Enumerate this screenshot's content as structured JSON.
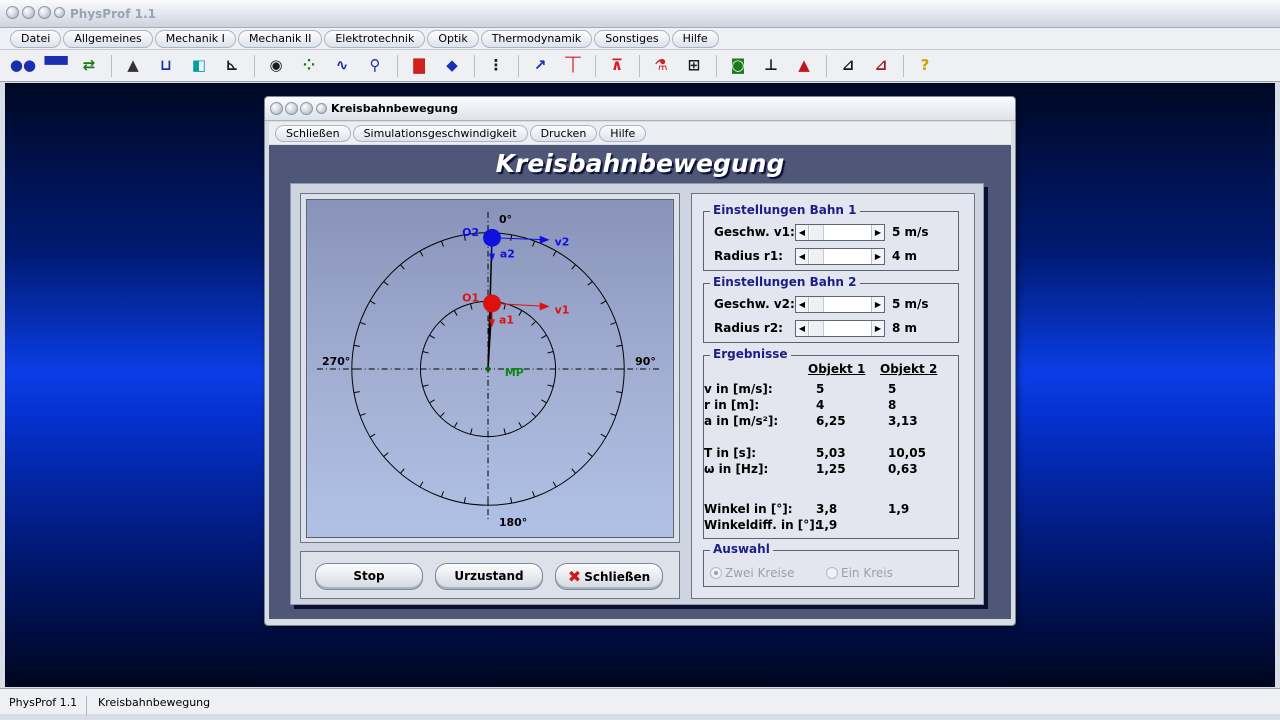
{
  "app": {
    "title": "PhysProf 1.1"
  },
  "menubar": [
    "Datei",
    "Allgemeines",
    "Mechanik I",
    "Mechanik II",
    "Elektrotechnik",
    "Optik",
    "Thermodynamik",
    "Sonstiges",
    "Hilfe"
  ],
  "toolbar": {
    "icons": [
      {
        "name": "collision-icon",
        "glyph": "●●",
        "color": "#1a2fb0"
      },
      {
        "name": "cart-icon",
        "glyph": "▀▀",
        "color": "#1a2fb0"
      },
      {
        "name": "exchange-icon",
        "glyph": "⇄",
        "color": "#1a7a1a"
      },
      {
        "name": "incline-icon",
        "glyph": "▲",
        "color": "#333333"
      },
      {
        "name": "container-icon",
        "glyph": "⊔",
        "color": "#1a2fb0"
      },
      {
        "name": "pulley-icon",
        "glyph": "◧",
        "color": "#00a0a0"
      },
      {
        "name": "graph-icon",
        "glyph": "⊾",
        "color": "#1a1a1a"
      },
      {
        "name": "eye-icon",
        "glyph": "◉",
        "color": "#1a1a1a"
      },
      {
        "name": "dots-icon",
        "glyph": "⁘",
        "color": "#1a7a1a"
      },
      {
        "name": "wave-icon",
        "glyph": "∿",
        "color": "#1a2fb0"
      },
      {
        "name": "orbit-icon",
        "glyph": "⚲",
        "color": "#1a2fb0"
      },
      {
        "name": "magnet-icon",
        "glyph": "▇",
        "color": "#d02020"
      },
      {
        "name": "diamond-icon",
        "glyph": "◆",
        "color": "#1a2fb0"
      },
      {
        "name": "resistor-icon",
        "glyph": "⋮",
        "color": "#1a1a1a"
      },
      {
        "name": "curve-icon",
        "glyph": "↗",
        "color": "#1a2fb0"
      },
      {
        "name": "circuit-icon",
        "glyph": "⏉",
        "color": "#d02020"
      },
      {
        "name": "coil-icon",
        "glyph": "⊼",
        "color": "#d02020"
      },
      {
        "name": "lab-icon",
        "glyph": "⚗",
        "color": "#d02020"
      },
      {
        "name": "network-icon",
        "glyph": "⊞",
        "color": "#1a1a1a"
      },
      {
        "name": "camera-icon",
        "glyph": "◙",
        "color": "#1a7a1a"
      },
      {
        "name": "piston-icon",
        "glyph": "⊥",
        "color": "#1a1a1a"
      },
      {
        "name": "spectrum-icon",
        "glyph": "▲",
        "color": "#c01818"
      },
      {
        "name": "decay-icon",
        "glyph": "⊿",
        "color": "#1a1a1a"
      },
      {
        "name": "histogram-icon",
        "glyph": "⊿",
        "color": "#a01818"
      },
      {
        "name": "help-icon",
        "glyph": "?",
        "color": "#c9a400"
      }
    ]
  },
  "dialog": {
    "title": "Kreisbahnbewegung",
    "menu": [
      "Schließen",
      "Simulationsgeschwindigkeit",
      "Drucken",
      "Hilfe"
    ],
    "heading": "Kreisbahnbewegung",
    "sim": {
      "angle_top": "0°",
      "angle_right": "90°",
      "angle_bottom": "180°",
      "angle_left": "270°",
      "center_label": "MP",
      "obj1": "O1",
      "obj2": "O2",
      "v1": "v1",
      "v2": "v2",
      "a1": "a1",
      "a2": "a2",
      "obj1_color": "#e01010",
      "obj2_color": "#1010e0",
      "center_color": "#0a8a0a"
    },
    "buttons": {
      "stop": "Stop",
      "reset": "Urzustand",
      "close": "Schließen"
    },
    "bahn1": {
      "title": "Einstellungen Bahn 1",
      "speed_label": "Geschw. v1:",
      "speed_value": "5 m/s",
      "radius_label": "Radius r1:",
      "radius_value": "4 m"
    },
    "bahn2": {
      "title": "Einstellungen Bahn 2",
      "speed_label": "Geschw. v2:",
      "speed_value": "5 m/s",
      "radius_label": "Radius r2:",
      "radius_value": "8 m"
    },
    "results": {
      "title": "Ergebnisse",
      "col1": "Objekt 1",
      "col2": "Objekt 2",
      "rows": [
        {
          "label": "v in [m/s]:",
          "o1": "5",
          "o2": "5"
        },
        {
          "label": "r in [m]:",
          "o1": "4",
          "o2": "8"
        },
        {
          "label": "a in [m/s²]:",
          "o1": "6,25",
          "o2": "3,13"
        },
        {
          "label": "T in [s]:",
          "o1": "5,03",
          "o2": "10,05"
        },
        {
          "label": "ω  in [Hz]:",
          "o1": "1,25",
          "o2": "0,63"
        },
        {
          "label": "Winkel in [°]:",
          "o1": "3,8",
          "o2": "1,9"
        },
        {
          "label": "Winkeldiff. in [°]:",
          "o1": "1,9",
          "o2": ""
        }
      ]
    },
    "auswahl": {
      "title": "Auswahl",
      "option1": "Zwei Kreise",
      "option2": "Ein Kreis"
    }
  },
  "status": {
    "app": "PhysProf 1.1",
    "module": "Kreisbahnbewegung"
  }
}
